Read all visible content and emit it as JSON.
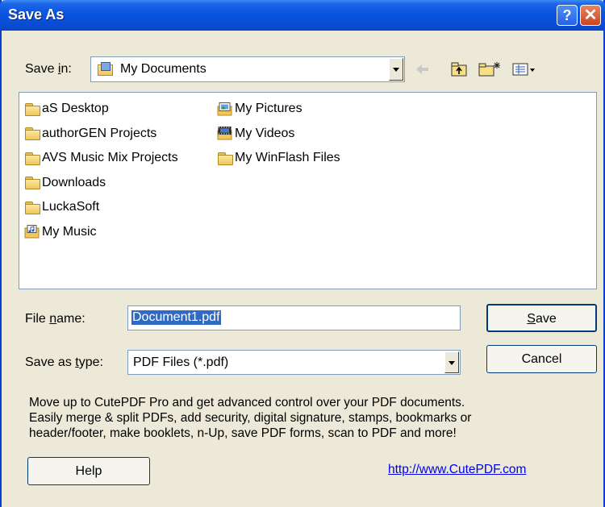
{
  "window": {
    "title": "Save As",
    "help_glyph": "?",
    "close_glyph": "✕"
  },
  "save_in": {
    "label_pre": "Save ",
    "label_ul": "i",
    "label_post": "n:",
    "value": "My Documents",
    "toolbar_icons": [
      "back-arrow-icon",
      "up-folder-icon",
      "new-folder-icon",
      "views-menu-icon"
    ]
  },
  "files": {
    "col1": [
      {
        "name": "aS Desktop",
        "icon": "folder-icon"
      },
      {
        "name": "authorGEN Projects",
        "icon": "folder-icon"
      },
      {
        "name": "AVS Music Mix Projects",
        "icon": "folder-icon"
      },
      {
        "name": "Downloads",
        "icon": "folder-icon"
      },
      {
        "name": "LuckaSoft",
        "icon": "folder-icon"
      },
      {
        "name": "My Music",
        "icon": "music-folder-icon"
      }
    ],
    "col2": [
      {
        "name": "My Pictures",
        "icon": "pictures-folder-icon"
      },
      {
        "name": "My Videos",
        "icon": "videos-folder-icon"
      },
      {
        "name": "My WinFlash Files",
        "icon": "folder-icon"
      }
    ]
  },
  "file_name": {
    "label_pre": "File ",
    "label_ul": "n",
    "label_post": "ame:",
    "value": "Document1.pdf"
  },
  "save_type": {
    "label_pre": "Save as ",
    "label_ul": "t",
    "label_post": "ype:",
    "value": "PDF Files (*.pdf)"
  },
  "buttons": {
    "save_ul": "S",
    "save_rest": "ave",
    "cancel": "Cancel",
    "help": "Help"
  },
  "promo": [
    "Move up to CutePDF Pro and get advanced control over your PDF documents.",
    "Easily merge & split PDFs, add security, digital signature, stamps, bookmarks or",
    "header/footer, make booklets, n-Up, save PDF forms, scan to PDF and more!"
  ],
  "link": "http://www.CutePDF.com",
  "colors": {
    "title_bar": "#0a54e0",
    "dialog_bg": "#ece9d8",
    "selection": "#316ac5",
    "link": "#0000ee"
  }
}
